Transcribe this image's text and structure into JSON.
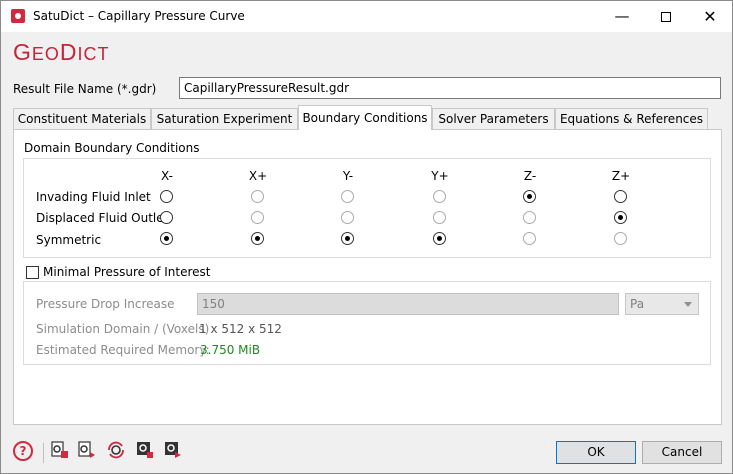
{
  "window": {
    "title": "SatuDict – Capillary Pressure Curve",
    "brand_first": "G",
    "brand_small1": "EO",
    "brand_second": "D",
    "brand_small2": "ICT"
  },
  "result_file": {
    "label": "Result File Name (*.gdr)",
    "value": "CapillaryPressureResult.gdr"
  },
  "tabs": [
    {
      "label": "Constituent Materials",
      "active": false
    },
    {
      "label": "Saturation Experiment",
      "active": false
    },
    {
      "label": "Boundary Conditions",
      "active": true
    },
    {
      "label": "Solver Parameters",
      "active": false
    },
    {
      "label": "Equations & References",
      "active": false
    }
  ],
  "boundary": {
    "group_title": "Domain Boundary Conditions",
    "columns": [
      "X-",
      "X+",
      "Y-",
      "Y+",
      "Z-",
      "Z+"
    ],
    "rows": [
      {
        "label": "Invading Fluid Inlet",
        "selected": "Z-"
      },
      {
        "label": "Displaced Fluid Outlet",
        "selected": "Z+"
      },
      {
        "label": "Symmetric",
        "selected": [
          "X-",
          "X+",
          "Y-",
          "Y+"
        ]
      }
    ]
  },
  "minimal_pressure": {
    "checkbox_label": "Minimal Pressure of Interest",
    "checked": false,
    "pressure_drop_label": "Pressure Drop Increase",
    "pressure_drop_value": "150",
    "unit": "Pa",
    "sim_domain_label": "Simulation Domain / (Voxels)",
    "sim_domain_value": "1 x 512 x 512",
    "memory_label": "Estimated Required Memory:",
    "memory_value": "3.750 MiB"
  },
  "footer": {
    "help_symbol": "?",
    "ok_label": "OK",
    "cancel_label": "Cancel"
  },
  "colors": {
    "brand": "#c8233a",
    "memory_value": "#1e8a1e",
    "accent_border": "#0078d7"
  },
  "icons": [
    "app-icon",
    "minimize-icon",
    "maximize-icon",
    "close-icon",
    "help-icon",
    "load-settings-icon",
    "save-settings-icon",
    "reset-settings-icon",
    "import-macro-icon",
    "export-macro-icon"
  ]
}
